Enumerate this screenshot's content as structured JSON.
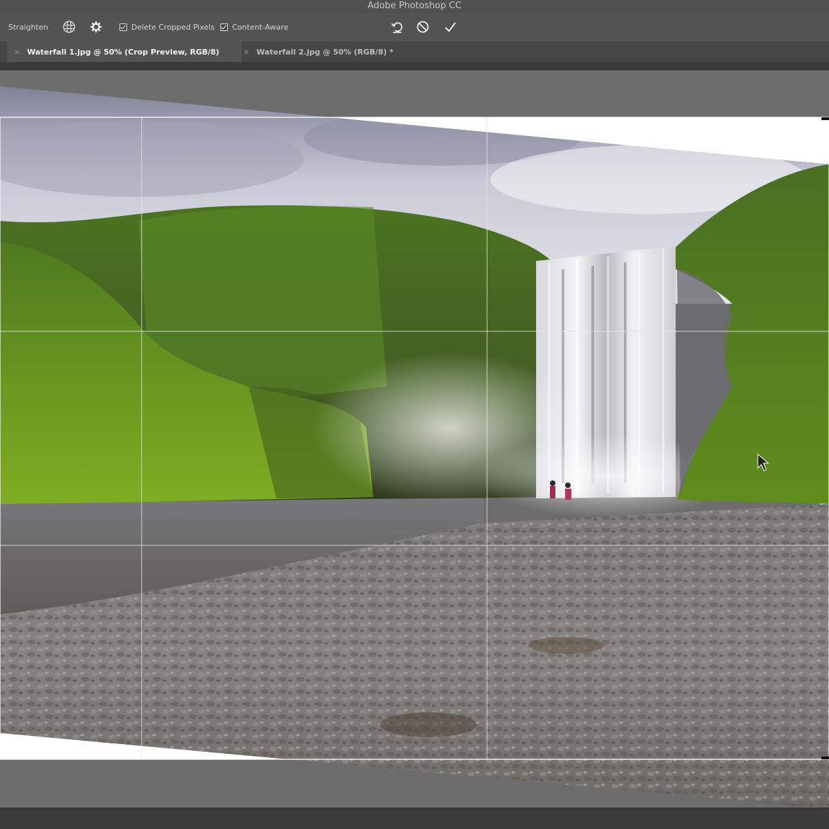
{
  "app": {
    "title": "Adobe Photoshop CC"
  },
  "options_bar": {
    "straighten_label": "Straighten",
    "overlay_icon": "grid-overlay-icon",
    "settings_icon": "gear-icon",
    "delete_cropped_pixels": {
      "label": "Delete Cropped Pixels",
      "checked": true
    },
    "content_aware": {
      "label": "Content-Aware",
      "checked": true
    },
    "reset_icon": "reset-icon",
    "cancel_icon": "cancel-icon",
    "commit_icon": "checkmark-icon"
  },
  "tabs": [
    {
      "label": "Waterfall 1.jpg @ 50% (Crop Preview, RGB/8)",
      "close": "×",
      "active": true
    },
    {
      "label": "Waterfall 2.jpg @ 50% (RGB/8) *",
      "close": "×",
      "active": false
    }
  ],
  "canvas": {
    "image_subject": "waterfall",
    "overlay": "rule-of-thirds",
    "crop_fill_color": "#ffffff"
  },
  "colors": {
    "ui_dark": "#535353",
    "ui_darker": "#464646",
    "canvas_bg": "#6e6e6e"
  }
}
